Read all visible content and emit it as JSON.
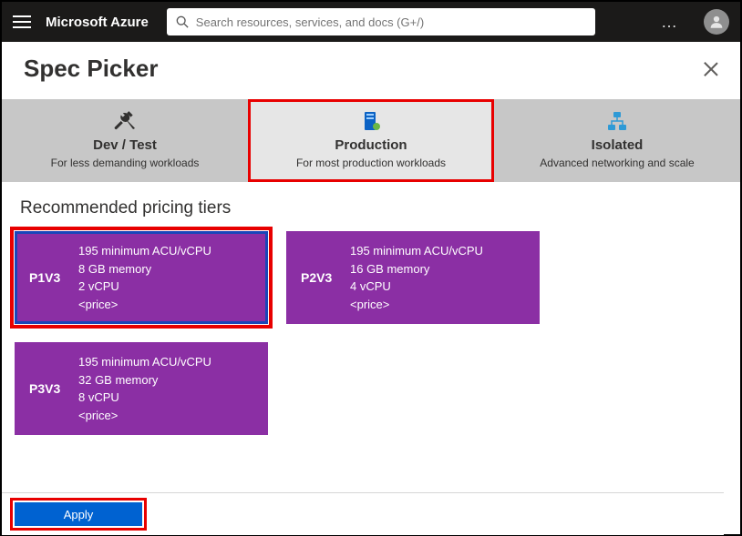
{
  "header": {
    "brand": "Microsoft Azure",
    "search_placeholder": "Search resources, services, and docs (G+/)",
    "more": "…"
  },
  "blade": {
    "title": "Spec Picker"
  },
  "categories": [
    {
      "id": "devtest",
      "title": "Dev / Test",
      "sub": "For less demanding workloads",
      "active": false,
      "highlight": false
    },
    {
      "id": "production",
      "title": "Production",
      "sub": "For most production workloads",
      "active": true,
      "highlight": true
    },
    {
      "id": "isolated",
      "title": "Isolated",
      "sub": "Advanced networking and scale",
      "active": false,
      "highlight": false
    }
  ],
  "section": {
    "title": "Recommended pricing tiers"
  },
  "tiers": [
    {
      "name": "P1V3",
      "acu": "195 minimum ACU/vCPU",
      "mem": "8 GB memory",
      "cpu": "2 vCPU",
      "price": "<price>",
      "selected": true
    },
    {
      "name": "P2V3",
      "acu": "195 minimum ACU/vCPU",
      "mem": "16 GB memory",
      "cpu": "4 vCPU",
      "price": "<price>",
      "selected": false
    },
    {
      "name": "P3V3",
      "acu": "195 minimum ACU/vCPU",
      "mem": "32 GB memory",
      "cpu": "8 vCPU",
      "price": "<price>",
      "selected": false
    }
  ],
  "footer": {
    "apply": "Apply"
  }
}
